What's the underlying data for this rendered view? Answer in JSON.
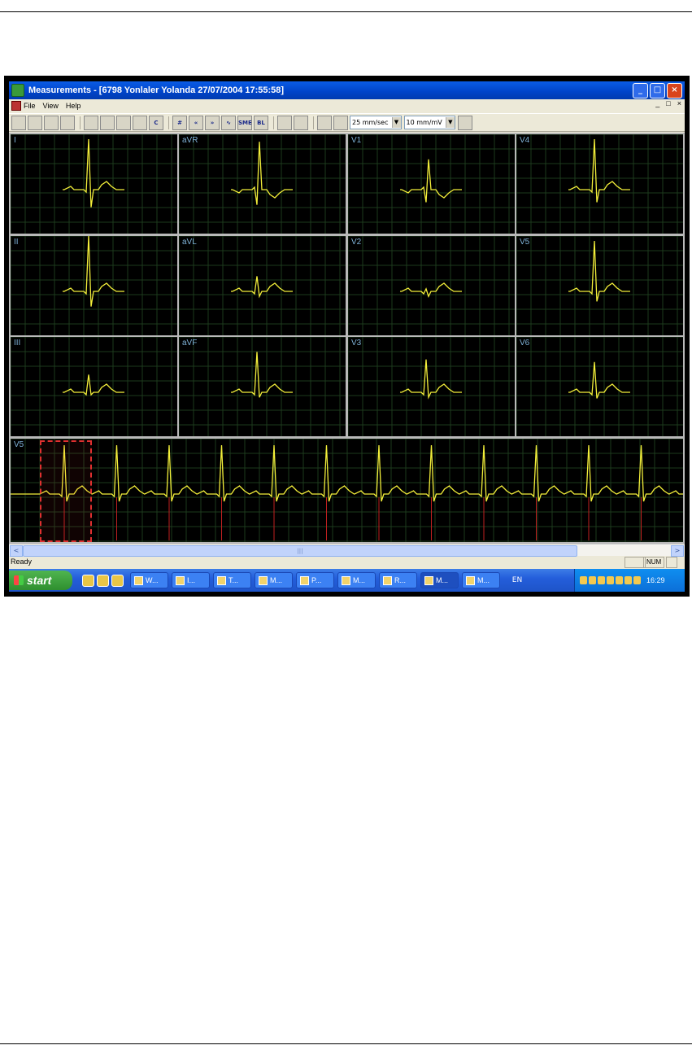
{
  "window": {
    "title": "Measurements - [6798 Yonlaler Yolanda  27/07/2004 17:55:58]",
    "minimize": "_",
    "restore": "□",
    "close": "×"
  },
  "menu": {
    "items": [
      "File",
      "View",
      "Help"
    ],
    "mdi_minimize": "_",
    "mdi_restore": "□",
    "mdi_close": "×"
  },
  "toolbar": {
    "icons": [
      "save-icon",
      "print-icon",
      "copy-icon",
      "edit-icon",
      "grid-table-icon",
      "lead-icon",
      "zoom-icon",
      "measure-icon"
    ],
    "c_label": "C",
    "buttons2": [
      "#",
      "«",
      "»",
      "∿",
      "SME",
      "BL"
    ],
    "speed": "25 mm/sec",
    "gain": "10 mm/mV"
  },
  "leads": {
    "I": "I",
    "aVR": "aVR",
    "V1": "V1",
    "V4": "V4",
    "II": "II",
    "aVL": "aVL",
    "V2": "V2",
    "V5": "V5",
    "III": "III",
    "aVF": "aVF",
    "V3": "V3",
    "V6": "V6",
    "rhythm": "V5"
  },
  "scrollbar": {
    "thumb": "|||",
    "left": "<",
    "right": ">"
  },
  "status": {
    "text": "Ready",
    "num": "NUM"
  },
  "taskbar": {
    "start": "start",
    "tasks": [
      "W...",
      "I...",
      "T...",
      "M...",
      "P...",
      "M...",
      "R...",
      "M...",
      "M..."
    ],
    "lang": "EN",
    "clock": "16:29"
  }
}
